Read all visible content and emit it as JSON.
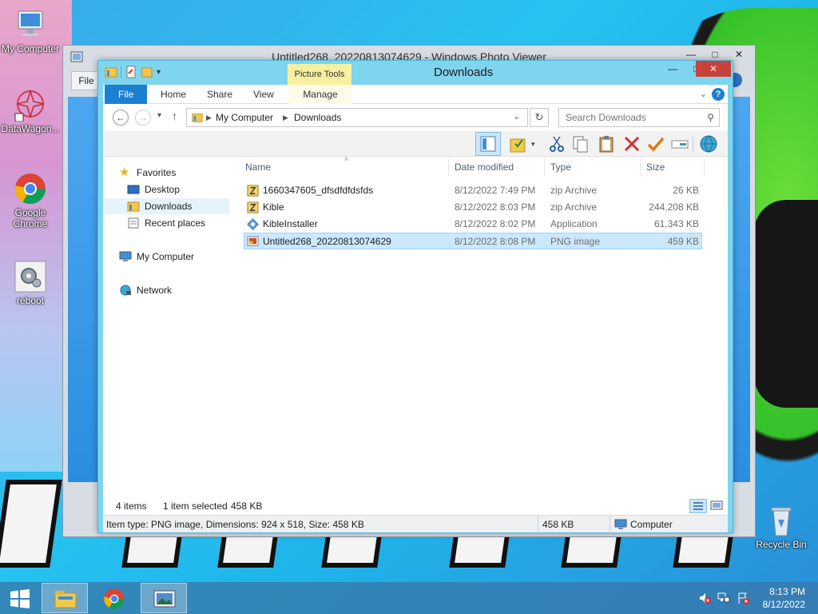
{
  "desktop": {
    "icons": [
      {
        "label": "My Computer"
      },
      {
        "label": "DataWagon..."
      },
      {
        "label": "Google Chrome"
      },
      {
        "label": "reboot"
      },
      {
        "label": "Recycle Bin"
      }
    ]
  },
  "photo_viewer": {
    "title": "Untitled268_20220813074629 - Windows Photo Viewer",
    "file_menu": "File"
  },
  "explorer": {
    "title": "Downloads",
    "context_tab": "Picture Tools",
    "ribbon_tabs": [
      "File",
      "Home",
      "Share",
      "View",
      "Manage"
    ],
    "breadcrumb": [
      "My Computer",
      "Downloads"
    ],
    "search_placeholder": "Search Downloads",
    "nav": {
      "favorites": "Favorites",
      "desktop": "Desktop",
      "downloads": "Downloads",
      "recent": "Recent places",
      "computer": "My Computer",
      "network": "Network"
    },
    "columns": {
      "name": "Name",
      "date": "Date modified",
      "type": "Type",
      "size": "Size"
    },
    "files": [
      {
        "name": "1660347605_dfsdfdfdsfds",
        "date": "8/12/2022 7:49 PM",
        "type": "zip Archive",
        "size": "26 KB"
      },
      {
        "name": "Kible",
        "date": "8/12/2022 8:03 PM",
        "type": "zip Archive",
        "size": "244,208 KB"
      },
      {
        "name": "KibleInstaller",
        "date": "8/12/2022 8:02 PM",
        "type": "Application",
        "size": "61,343 KB"
      },
      {
        "name": "Untitled268_20220813074629",
        "date": "8/12/2022 8:08 PM",
        "type": "PNG image",
        "size": "459 KB"
      }
    ],
    "status": {
      "items": "4 items",
      "selected": "1 item selected",
      "selected_size": "458 KB"
    },
    "details_bar": {
      "info": "Item type: PNG image, Dimensions: 924 x 518, Size: 458 KB",
      "size": "458 KB",
      "location": "Computer"
    }
  },
  "taskbar": {
    "time": "8:13 PM",
    "date": "8/12/2022"
  },
  "colors": {
    "file_tab": "#1c7fd2",
    "selection": "#cce8ff",
    "explorer_frame": "#7fd4ee",
    "close_button": "#c7423a"
  }
}
